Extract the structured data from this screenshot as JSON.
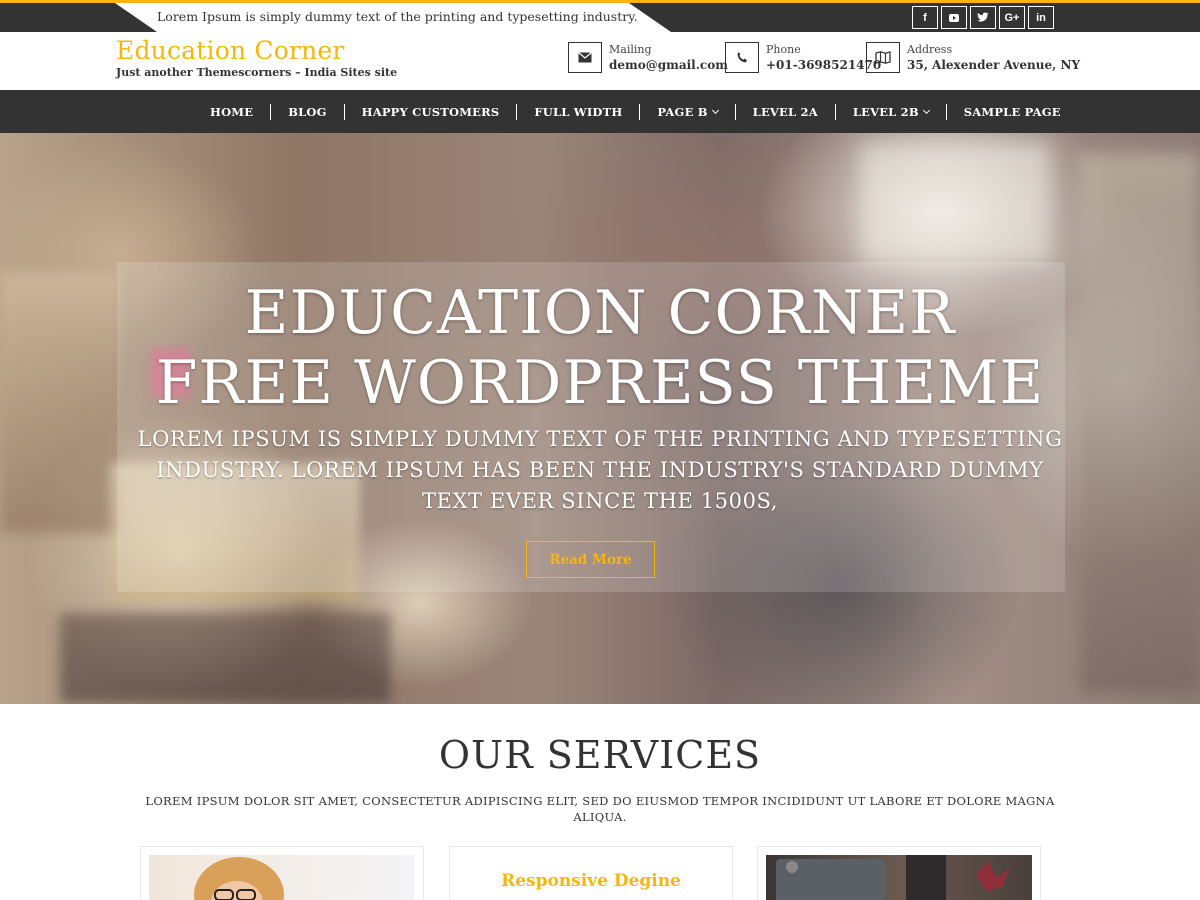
{
  "topbar": {
    "note": "Lorem Ipsum is simply dummy text of the printing and typesetting industry.",
    "social": [
      {
        "icon": "facebook-icon",
        "glyph": "f"
      },
      {
        "icon": "youtube-icon",
        "glyph": "▶"
      },
      {
        "icon": "twitter-icon",
        "glyph": "t"
      },
      {
        "icon": "google-plus-icon",
        "glyph": "G+"
      },
      {
        "icon": "linkedin-icon",
        "glyph": "in"
      }
    ]
  },
  "header": {
    "site_title": "Education Corner",
    "tagline": "Just another Themescorners – India Sites site",
    "mailing": {
      "label": "Mailing",
      "value": "demo@gmail.com",
      "icon": "envelope-icon"
    },
    "phone": {
      "label": "Phone",
      "value": "+01-3698521470",
      "icon": "phone-icon"
    },
    "address": {
      "label": "Address",
      "value": "35, Alexender Avenue, NY",
      "icon": "map-icon"
    }
  },
  "nav": {
    "items": [
      {
        "label": "HOME",
        "dropdown": false
      },
      {
        "label": "BLOG",
        "dropdown": false
      },
      {
        "label": "HAPPY CUSTOMERS",
        "dropdown": false
      },
      {
        "label": "FULL WIDTH",
        "dropdown": false
      },
      {
        "label": "PAGE B",
        "dropdown": true
      },
      {
        "label": "LEVEL 2A",
        "dropdown": false
      },
      {
        "label": "LEVEL 2B",
        "dropdown": true
      },
      {
        "label": "SAMPLE PAGE",
        "dropdown": false
      }
    ]
  },
  "hero": {
    "title_line1": "EDUCATION CORNER",
    "title_line2": "FREE WORDPRESS THEME",
    "sub_line1": "LOREM IPSUM IS SIMPLY DUMMY TEXT OF THE PRINTING AND TYPESETTING",
    "sub_line2": "INDUSTRY. LOREM IPSUM HAS BEEN THE INDUSTRY'S STANDARD DUMMY",
    "sub_line3": "TEXT EVER SINCE THE 1500S,",
    "button_label": "Read More"
  },
  "services": {
    "title": "OUR SERVICES",
    "description": "LOREM IPSUM DOLOR SIT AMET, CONSECTETUR ADIPISCING ELIT, SED DO EIUSMOD TEMPOR INCIDIDUNT UT LABORE ET DOLORE MAGNA ALIQUA.",
    "card_middle_title": "Responsive Degine"
  },
  "colors": {
    "accent": "#f6b60e",
    "dark_bar": "#333333"
  }
}
